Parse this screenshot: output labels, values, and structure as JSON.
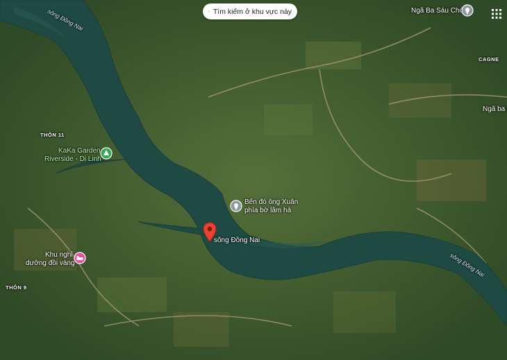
{
  "search": {
    "placeholder": "Tìm kiếm ở khu vực này",
    "icon": "search-icon"
  },
  "apps_icon": "apps-grid-icon",
  "labels": {
    "river_top": "sông Đồng Nai",
    "river_right": "sông Đồng Nai",
    "nga_ba_sau_cho": "Ngã Ba Sáu Chó",
    "cagne": "CAGNE",
    "nga_ba_kh": "Ngã ba Kh",
    "thon_11": "THÔN 11",
    "thon_9": "THÔN 9",
    "kaka_line1": "KaKa Garden",
    "kaka_line2": "Riverside - Di Linh",
    "ben_do_line1": "Bến đò ông Xuân",
    "ben_do_line2": "phía bờ lâm hà",
    "khu_nghi_line1": "Khu nghỉ",
    "khu_nghi_line2": "dưỡng đồi vàng",
    "selected_place": "sông Đồng Nai"
  },
  "colors": {
    "land": "#3e5a2e",
    "water": "#1f4a44",
    "selected_pin": "#ea4335",
    "park_pin": "#34a853",
    "hotel_pin": "#e94ea0",
    "gray_pin": "#8d979e"
  }
}
